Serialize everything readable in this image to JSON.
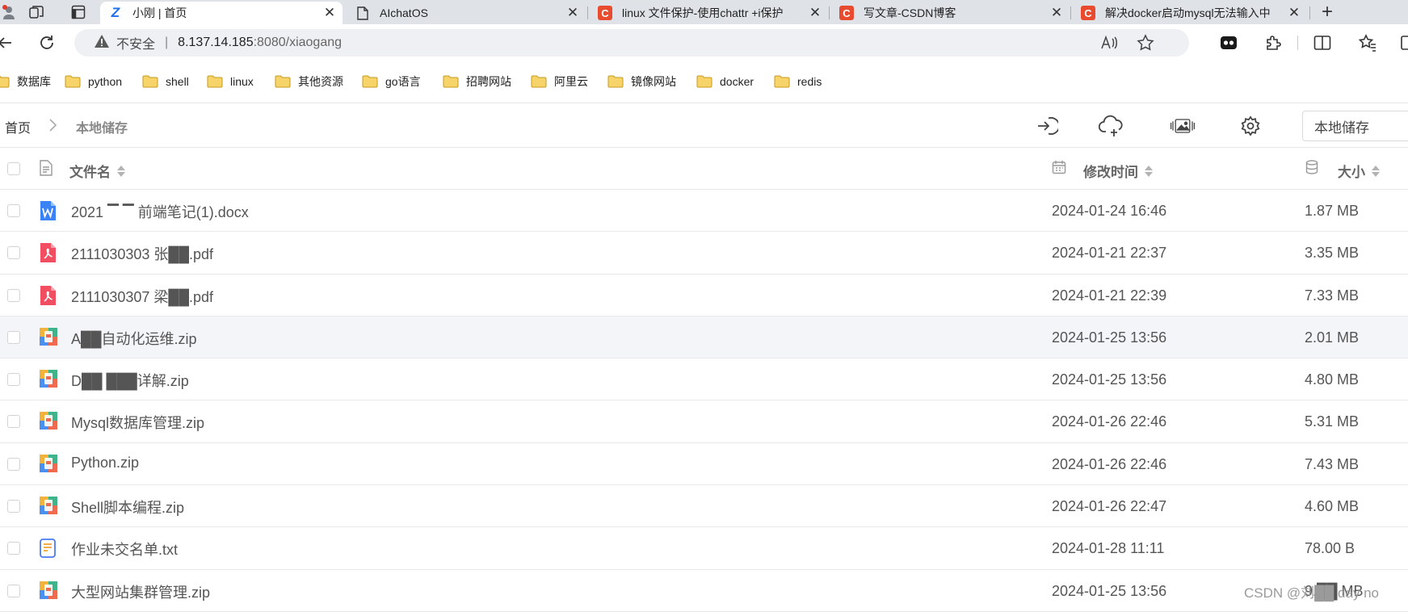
{
  "browser": {
    "tabs": [
      {
        "title": "小刚 | 首页",
        "favicon": "z-logo-icon",
        "active": true
      },
      {
        "title": "AIchatOS",
        "favicon": "page-icon",
        "active": false
      },
      {
        "title": "linux 文件保护-使用chattr +i保护",
        "favicon": "csdn-icon",
        "active": false
      },
      {
        "title": "写文章-CSDN博客",
        "favicon": "csdn-icon",
        "active": false
      },
      {
        "title": "解决docker启动mysql无法输入中",
        "favicon": "csdn-icon",
        "active": false
      }
    ],
    "csdn_favicon_letter": "C",
    "z_favicon_letter": "Z",
    "new_tab_symbol": "+",
    "close_symbol": "✕",
    "address": {
      "security_label": "不安全",
      "separator": "|",
      "host": "8.137.14.185",
      "path": ":8080/xiaogang"
    },
    "bookmarks": [
      "数据库",
      "python",
      "shell",
      "linux",
      "其他资源",
      "go语言",
      "招聘网站",
      "阿里云",
      "镜像网站",
      "docker",
      "redis"
    ]
  },
  "app": {
    "breadcrumb": {
      "home": "首页",
      "current": "本地储存"
    },
    "storage_select": "本地储存",
    "columns": {
      "name": "文件名",
      "modified": "修改时间",
      "size": "大小"
    },
    "files": [
      {
        "name": "2021 ▔ ▔ 前端笔记(1).docx",
        "modified": "2024-01-24 16:46",
        "size": "1.87 MB",
        "type": "docx"
      },
      {
        "name": "2111030303 张██.pdf",
        "modified": "2024-01-21 22:37",
        "size": "3.35 MB",
        "type": "pdf"
      },
      {
        "name": "2111030307 梁██.pdf",
        "modified": "2024-01-21 22:39",
        "size": "7.33 MB",
        "type": "pdf"
      },
      {
        "name": "A██自动化运维.zip",
        "modified": "2024-01-25 13:56",
        "size": "2.01 MB",
        "type": "zip"
      },
      {
        "name": "D██ ███详解.zip",
        "modified": "2024-01-25 13:56",
        "size": "4.80 MB",
        "type": "zip"
      },
      {
        "name": "Mysql数据库管理.zip",
        "modified": "2024-01-26 22:46",
        "size": "5.31 MB",
        "type": "zip"
      },
      {
        "name": "Python.zip",
        "modified": "2024-01-26 22:46",
        "size": "7.43 MB",
        "type": "zip"
      },
      {
        "name": "Shell脚本编程.zip",
        "modified": "2024-01-26 22:47",
        "size": "4.60 MB",
        "type": "zip"
      },
      {
        "name": "作业未交名单.txt",
        "modified": "2024-01-28 11:11",
        "size": "78.00 B",
        "type": "txt"
      },
      {
        "name": "大型网站集群管理.zip",
        "modified": "2024-01-25 13:56",
        "size": "9.██ MB",
        "type": "zip"
      }
    ],
    "hovered_row": 3
  },
  "watermark": "CSDN @刘██ day no"
}
